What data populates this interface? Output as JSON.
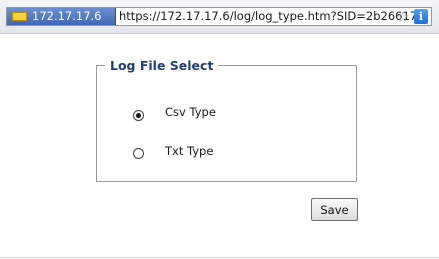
{
  "browser": {
    "site_host": "172.17.17.6",
    "url": "https://172.17.17.6/log/log_type.htm?SID=2b26617",
    "site_icon": "site-identity-icon",
    "bookmark_icon": "star-icon",
    "info_icon": "info-icon",
    "info_glyph": "i"
  },
  "form": {
    "legend": "Log File Select",
    "options": [
      {
        "label": "Csv Type",
        "selected": true
      },
      {
        "label": "Txt Type",
        "selected": false
      }
    ],
    "save_label": "Save"
  },
  "colors": {
    "legend_text": "#1f3e7a",
    "site_chip": "#3f67b6"
  }
}
